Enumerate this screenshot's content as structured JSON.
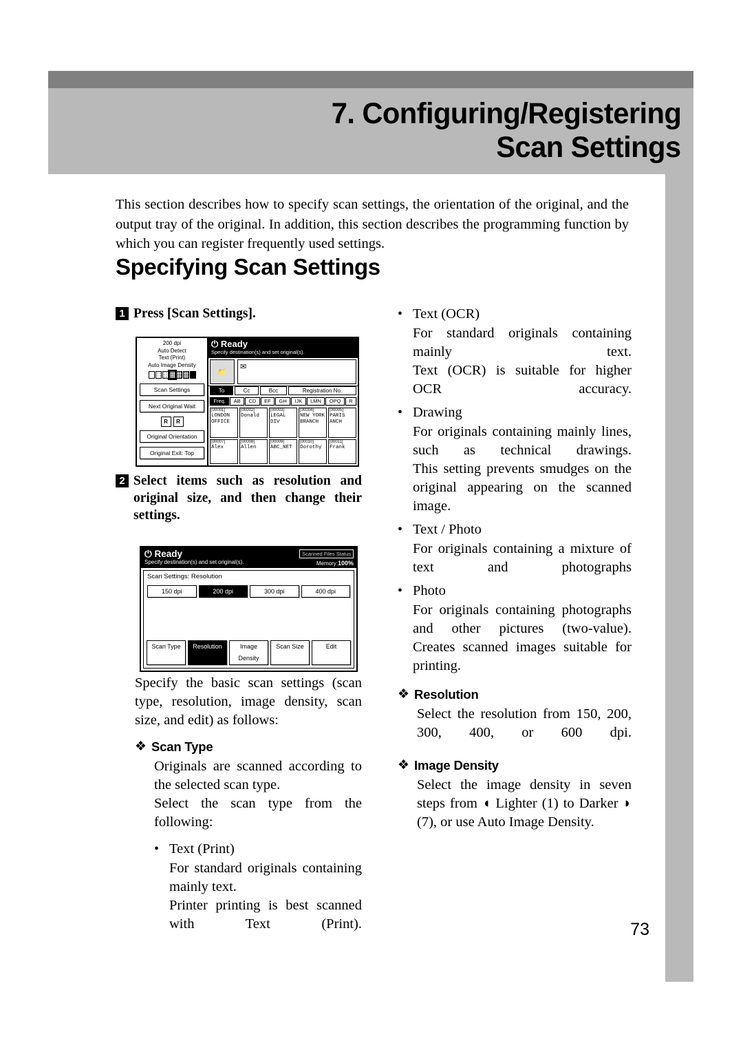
{
  "chapter": {
    "title_line1": "7. Configuring/Registering",
    "title_line2": "Scan Settings"
  },
  "intro": "This section describes how to specify scan settings, the orientation of the original, and the output tray of the original. In addition, this section describes the programming function by which you can register frequently used settings.",
  "section_heading": "Specifying Scan Settings",
  "steps": {
    "one": {
      "num": "1",
      "text": "Press [Scan Settings]."
    },
    "two": {
      "num": "2",
      "text": "Select items such as resolution and original size, and then change their settings."
    }
  },
  "after_step2_para": "Specify the basic scan settings (scan type, resolution, image density, scan size, and edit) as follows:",
  "diamonds": {
    "scan_type": {
      "label": "Scan Type",
      "body_line1": "Originals are scanned according to the selected scan type.",
      "body_line2": "Select the scan type from the following:"
    },
    "resolution": {
      "label": "Resolution",
      "body": "Select the resolution from 150, 200, 300, 400, or 600 dpi."
    },
    "image_density": {
      "label": "Image Density",
      "body_a": "Select the image density in seven steps from",
      "lighter": "Lighter (1) to",
      "darker": "Darker",
      "body_b": "(7), or use Auto Image Density."
    }
  },
  "scan_type_bullets": [
    {
      "title": "Text (Print)",
      "lines": [
        "For standard originals containing mainly text.",
        "Printer printing is best scanned with Text (Print)."
      ]
    },
    {
      "title": "Text (OCR)",
      "lines": [
        "For standard originals containing mainly text.",
        "Text (OCR) is suitable for higher OCR accuracy."
      ]
    },
    {
      "title": "Drawing",
      "lines": [
        "For originals containing mainly lines, such as technical drawings.",
        "This setting prevents smudges on the original appearing on the scanned image."
      ]
    },
    {
      "title": "Text / Photo",
      "lines": [
        "For originals containing a mixture of text and photographs"
      ]
    },
    {
      "title": "Photo",
      "lines": [
        "For originals containing photographs and other pictures (two-value).",
        "Creates scanned images suitable for printing."
      ]
    }
  ],
  "page_number": "73",
  "screenshot1": {
    "status_lines": [
      "200 dpi",
      "Auto Detect",
      "Text (Print)",
      "Auto Image Density"
    ],
    "buttons": [
      "Scan Settings",
      "Next Original Wait",
      "Original Orientation",
      "Original Exit: Top"
    ],
    "orientation_icons": [
      "R",
      "R"
    ],
    "ready": "Ready",
    "subtitle": "Specify destination(s) and set original(s).",
    "dest_tabs": [
      "To",
      "Cc",
      "Bcc",
      "Registration No."
    ],
    "alpha_tabs": [
      "Freq.",
      "AB",
      "CD",
      "EF",
      "GH",
      "IJK",
      "LMN",
      "OPQ",
      "R"
    ],
    "entries_row1": [
      {
        "id": "[00001]",
        "name": "LONDON OFFICE"
      },
      {
        "id": "[00002]",
        "name": "Donald"
      },
      {
        "id": "[00003]",
        "name": "LEGAL DIV"
      },
      {
        "id": "[00004]",
        "name": "NEW YORK BRANCH"
      },
      {
        "id": "[00005]",
        "name": "PARIS ANCH"
      }
    ],
    "entries_row2": [
      {
        "id": "[00007]",
        "name": "Alex"
      },
      {
        "id": "[00008]",
        "name": "Allen"
      },
      {
        "id": "[00009]",
        "name": "ABC_NET"
      },
      {
        "id": "[00010]",
        "name": "Dorothy"
      },
      {
        "id": "[00011]",
        "name": "Frank"
      }
    ]
  },
  "screenshot2": {
    "ready": "Ready",
    "subtitle": "Specify destination(s) and set original(s).",
    "file_status": "Scanned Files Status",
    "memory_label": "Memory:",
    "memory_value": "100%",
    "panel_heading": "Scan Settings: Resolution",
    "resolution_options": [
      "150 dpi",
      "200 dpi",
      "300 dpi",
      "400 dpi"
    ],
    "resolution_selected": "200 dpi",
    "bottom_tabs": [
      "Scan Type",
      "Resolution",
      "Image Density",
      "Scan Size",
      "Edit"
    ],
    "bottom_tab_selected": "Resolution"
  },
  "colors": {
    "banner_dark": "#808080",
    "banner_light": "#b9b9b9",
    "text": "#000000"
  }
}
